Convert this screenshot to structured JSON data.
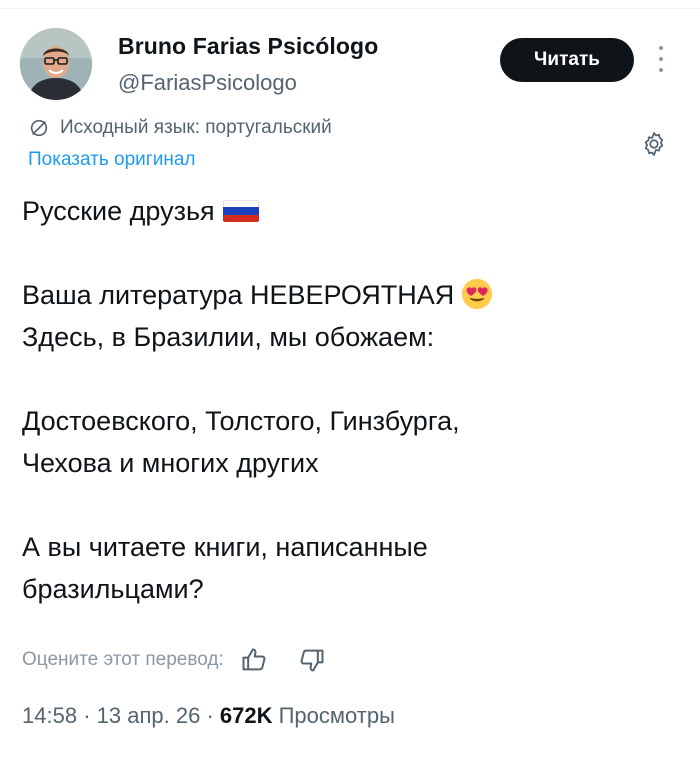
{
  "author": {
    "name": "Bruno Farias Psicólogo",
    "handle": "@FariasPsicologo"
  },
  "actions": {
    "follow_label": "Читать"
  },
  "translation": {
    "source_language": "Исходный язык: португальский",
    "show_original": "Показать оригинал"
  },
  "tweet": {
    "line1": "Русские друзья",
    "line3": "Ваша литература НЕВЕРОЯТНАЯ",
    "line4": "Здесь, в Бразилии, мы обожаем:",
    "line6": "Достоевского, Толстого, Гинзбурга,",
    "line7": "Чехова и многих других",
    "line9": "А вы читаете книги, написанные",
    "line10": "бразильцами?",
    "emojis": [
      "russia-flag",
      "heart-eyes-face"
    ]
  },
  "rating": {
    "prompt": "Оцените этот перевод:"
  },
  "meta": {
    "time": "14:58",
    "date": "13 апр. 26",
    "views_count": "672K",
    "views_label": "Просмотры",
    "separator": "·"
  },
  "colors": {
    "accent": "#1d9bf0",
    "text_primary": "#0f1419",
    "text_secondary": "#536471",
    "button_bg": "#0f1419"
  }
}
